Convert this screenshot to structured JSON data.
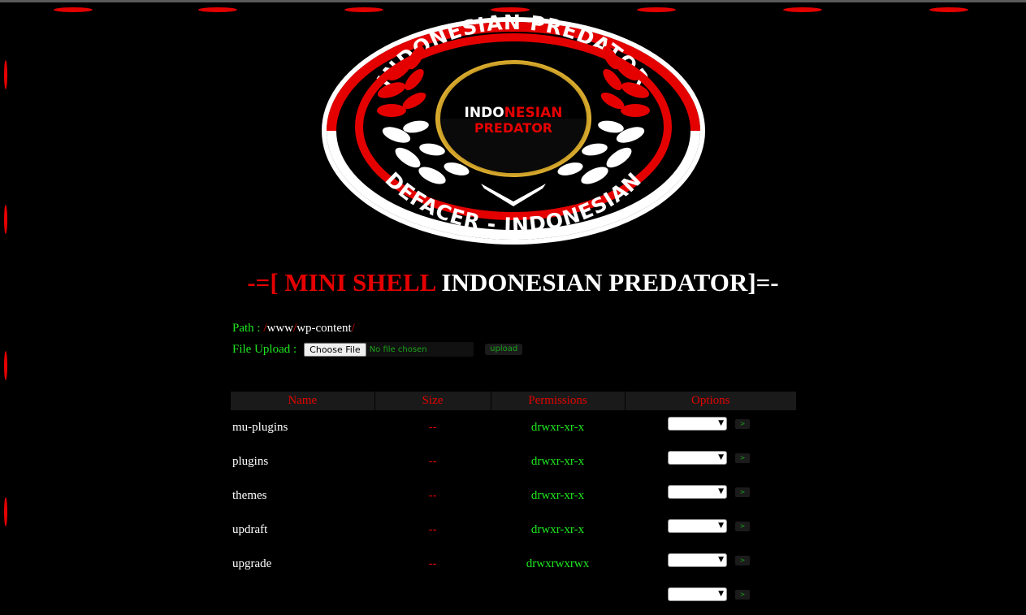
{
  "logo": {
    "text_top": "INDONESIAN PREDATOR",
    "text_bottom": "DEFACER - INDONESIAN",
    "center_line1_a": "INDO",
    "center_line1_b": "NESIAN",
    "center_line2": "PREDATOR"
  },
  "title": {
    "prefix": "-=[ MINI SHELL",
    "main": " INDONESIAN PREDATOR",
    "suffix": "]=-"
  },
  "path": {
    "label": "Path : ",
    "segments": [
      "/",
      "www",
      "/",
      "wp-content",
      "/"
    ]
  },
  "upload": {
    "label": "File Upload : ",
    "choose_label": "Choose File",
    "no_file_text": "No file chosen",
    "button_label": "upload"
  },
  "table": {
    "headers": [
      "Name",
      "Size",
      "Permissions",
      "Options"
    ],
    "rows": [
      {
        "name": "mu-plugins",
        "size": "--",
        "perm": "drwxr-xr-x"
      },
      {
        "name": "plugins",
        "size": "--",
        "perm": "drwxr-xr-x"
      },
      {
        "name": "themes",
        "size": "--",
        "perm": "drwxr-xr-x"
      },
      {
        "name": "updraft",
        "size": "--",
        "perm": "drwxr-xr-x"
      },
      {
        "name": "upgrade",
        "size": "--",
        "perm": "drwxrwxrwx"
      }
    ],
    "go_label": ">"
  },
  "colors": {
    "red": "#e50000",
    "green": "#1ee81e",
    "background": "#000000"
  }
}
